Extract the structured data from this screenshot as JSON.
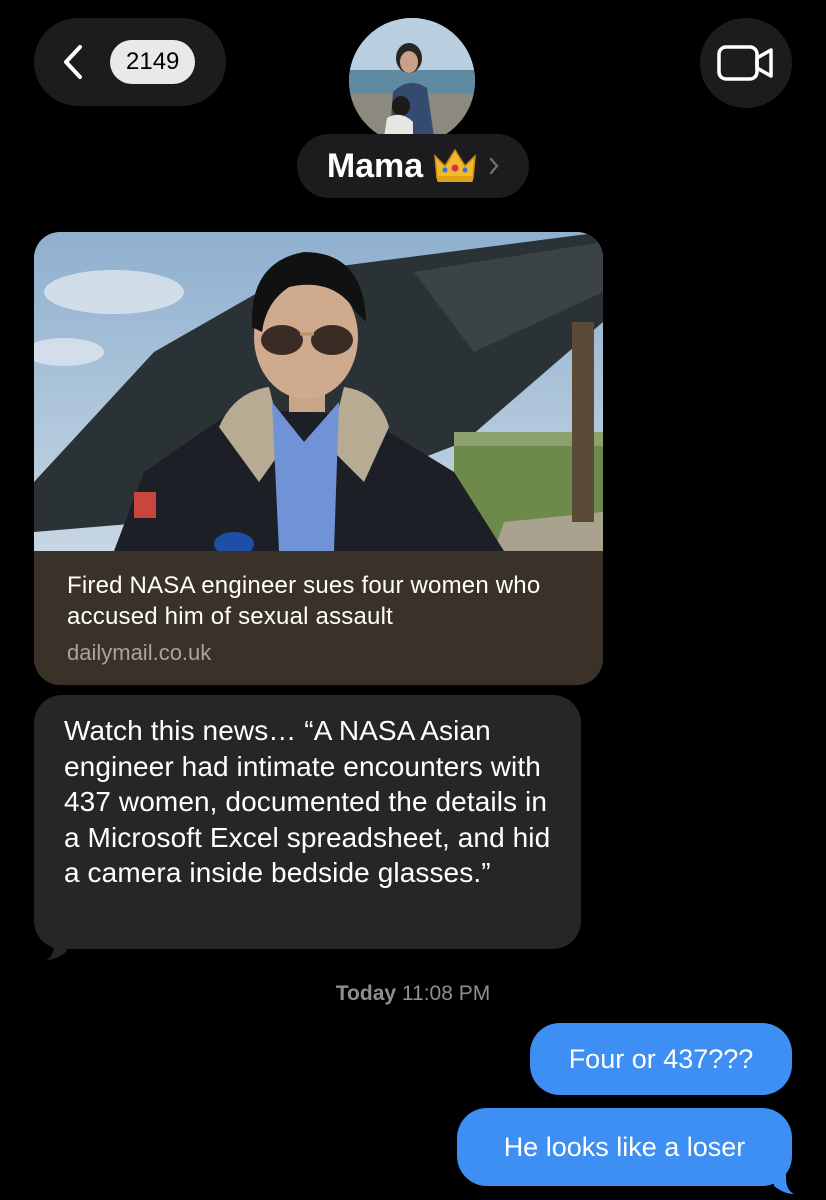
{
  "header": {
    "unread_count": "2149",
    "contact_name": "Mama",
    "contact_emoji": "crown-emoji"
  },
  "link_preview": {
    "title": "Fired NASA engineer sues four women who accused him of sexual assault",
    "domain": "dailymail.co.uk"
  },
  "messages": {
    "incoming_1": "Watch this news… “A NASA Asian engineer had intimate encounters with 437 women, documented the details in a Microsoft Excel spreadsheet, and hid a camera inside bedside glasses.”",
    "timestamp_day": "Today",
    "timestamp_time": "11:08 PM",
    "outgoing_1": "Four or 437???",
    "outgoing_2": "He looks like a loser"
  },
  "colors": {
    "background": "#000000",
    "incoming_bubble": "#262628",
    "outgoing_bubble": "#3e8ff3",
    "header_pill": "#1c1c1e",
    "link_card_footer": "#3a3129"
  }
}
